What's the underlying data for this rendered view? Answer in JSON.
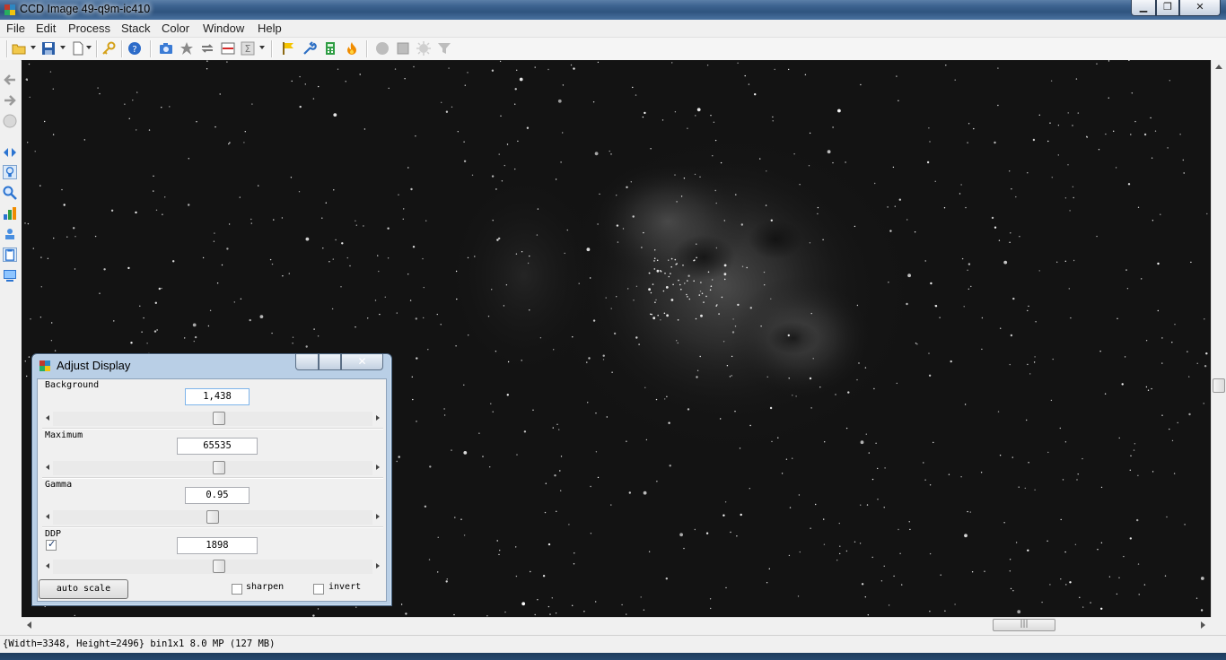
{
  "window": {
    "title": "CCD Image 49-q9m-ic410",
    "min_glyph": "▁",
    "max_glyph": "❐",
    "close_glyph": "✕"
  },
  "menu": [
    "File",
    "Edit",
    "Process",
    "Stack",
    "Color",
    "Window",
    "Help"
  ],
  "toolbar_icons": [
    "open-folder-icon",
    "save-disk-icon",
    "new-document-icon",
    "key-icon",
    "help-icon",
    "camera-icon",
    "star-icon",
    "loop-arrows-icon",
    "red-line-icon",
    "sigma-icon",
    "flag-icon",
    "wrench-icon",
    "calculator-icon",
    "flame-icon",
    "circle-icon",
    "square-icon",
    "starburst-icon",
    "filter-funnel-icon"
  ],
  "left_tools": [
    "back-arrow-icon",
    "forward-arrow-icon",
    "stop-icon",
    "pan-arrows-icon",
    "lightbulb-icon",
    "magnifier-icon",
    "histogram-icon",
    "stamp-icon",
    "clipboard-icon",
    "monitor-icon"
  ],
  "adjust_display": {
    "title": "Adjust Display",
    "close_glyph": "✕",
    "background": {
      "label": "Background",
      "value": "1,438",
      "slider_level": 0.52
    },
    "maximum": {
      "label": "Maximum",
      "value": "65535",
      "slider_level": 0.52
    },
    "gamma": {
      "label": "Gamma",
      "value": "0.95",
      "slider_level": 0.5
    },
    "ddp": {
      "label": "DDP",
      "value": "1898",
      "checked": true,
      "slider_level": 0.52
    },
    "auto_scale_label": "auto scale",
    "sharpen_label": "sharpen",
    "sharpen_checked": false,
    "invert_label": "invert",
    "invert_checked": false
  },
  "hscroll_grip": "|||",
  "status": {
    "text": "{Width=3348, Height=2496} bin1x1  8.0 MP (127 MB)"
  },
  "colors": {
    "image_background": "#101010",
    "title_bar": "#3d6390",
    "dialog_frame": "#b9cfe6"
  }
}
